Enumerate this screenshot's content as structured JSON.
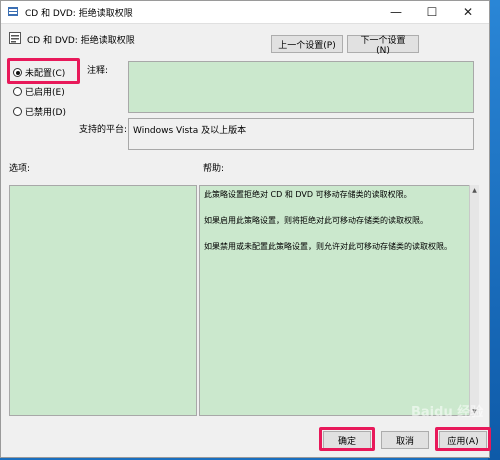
{
  "window": {
    "title": "CD 和 DVD: 拒绝读取权限",
    "minimize_glyph": "—",
    "maximize_glyph": "☐",
    "close_glyph": "✕"
  },
  "header": {
    "title": "CD 和 DVD: 拒绝读取权限",
    "icon": "policy-settings-icon"
  },
  "nav": {
    "prev_label": "上一个设置(P)",
    "next_label": "下一个设置(N)"
  },
  "state_options": [
    {
      "label": "未配置(C)",
      "selected": true
    },
    {
      "label": "已启用(E)",
      "selected": false
    },
    {
      "label": "已禁用(D)",
      "selected": false
    }
  ],
  "fields": {
    "comment_label": "注释:",
    "comment_value": "",
    "platform_label": "支持的平台:",
    "platform_value": "Windows Vista 及以上版本"
  },
  "options": {
    "label": "选项:"
  },
  "help": {
    "label": "帮助:",
    "paragraphs": [
      "此策略设置拒绝对 CD 和 DVD 可移动存储类的读取权限。",
      "如果启用此策略设置，则将拒绝对此可移动存储类的读取权限。",
      "如果禁用或未配置此策略设置，则允许对此可移动存储类的读取权限。"
    ]
  },
  "footer": {
    "ok_label": "确定",
    "cancel_label": "取消",
    "apply_label": "应用(A)"
  },
  "colors": {
    "highlight": "#e8195a",
    "pane_fill": "#cbe8cd",
    "dialog_bg": "#f0f0f0"
  },
  "watermark": "Baidu 经验"
}
